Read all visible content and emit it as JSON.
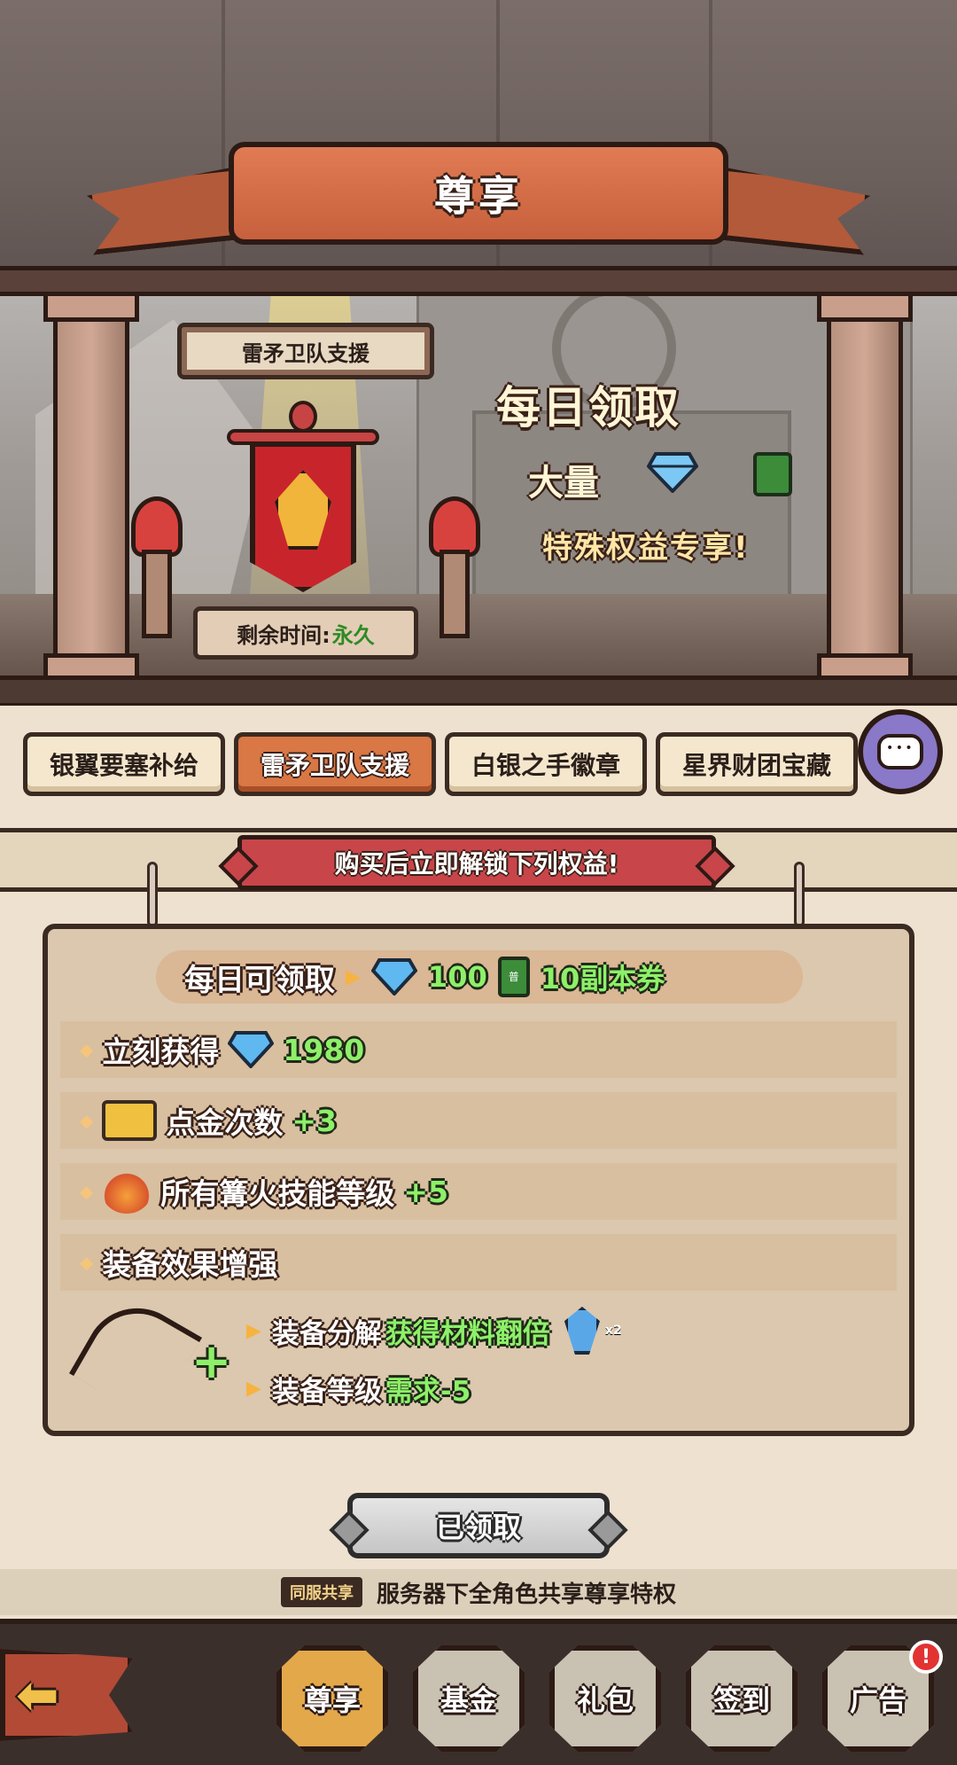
{
  "header": {
    "title": "尊享"
  },
  "scene": {
    "sign_title": "雷矛卫队支援",
    "timer_label": "剩余时间:",
    "timer_value": "永久",
    "promo_line1": "每日领取",
    "promo_line2": "大量",
    "promo_line3": "特殊权益专享!"
  },
  "tabs": [
    {
      "label": "银翼要塞补给",
      "active": false
    },
    {
      "label": "雷矛卫队支援",
      "active": true
    },
    {
      "label": "白银之手徽章",
      "active": false
    },
    {
      "label": "星界财团宝藏",
      "active": false
    }
  ],
  "unlock_banner": "购买后立即解锁下列权益!",
  "daily": {
    "label": "每日可领取",
    "gem_amount": "100",
    "ticket_text": "10副本券",
    "ticket_icon_text": "普"
  },
  "benefits": {
    "instant_label": "立刻获得",
    "instant_value": "1980",
    "gold_label": "点金次数",
    "gold_value": "+3",
    "fire_label": "所有篝火技能等级",
    "fire_value": "+5",
    "equip_title": "装备效果增强",
    "equip_line1_a": "装备分解",
    "equip_line1_b": "获得材料翻倍",
    "equip_line1_mult": "x2",
    "equip_line2_a": "装备等级",
    "equip_line2_b": "需求-5"
  },
  "claim_button": "已领取",
  "share": {
    "badge": "同服共享",
    "text": "服务器下全角色共享尊享特权"
  },
  "nav": [
    {
      "label": "尊享",
      "active": true
    },
    {
      "label": "基金",
      "active": false
    },
    {
      "label": "礼包",
      "active": false
    },
    {
      "label": "签到",
      "active": false
    },
    {
      "label": "广告",
      "active": false
    }
  ],
  "alert_badge": "!",
  "colors": {
    "accent_orange": "#d97745",
    "value_green": "#8ef06a",
    "parchment": "#eee1cf"
  }
}
